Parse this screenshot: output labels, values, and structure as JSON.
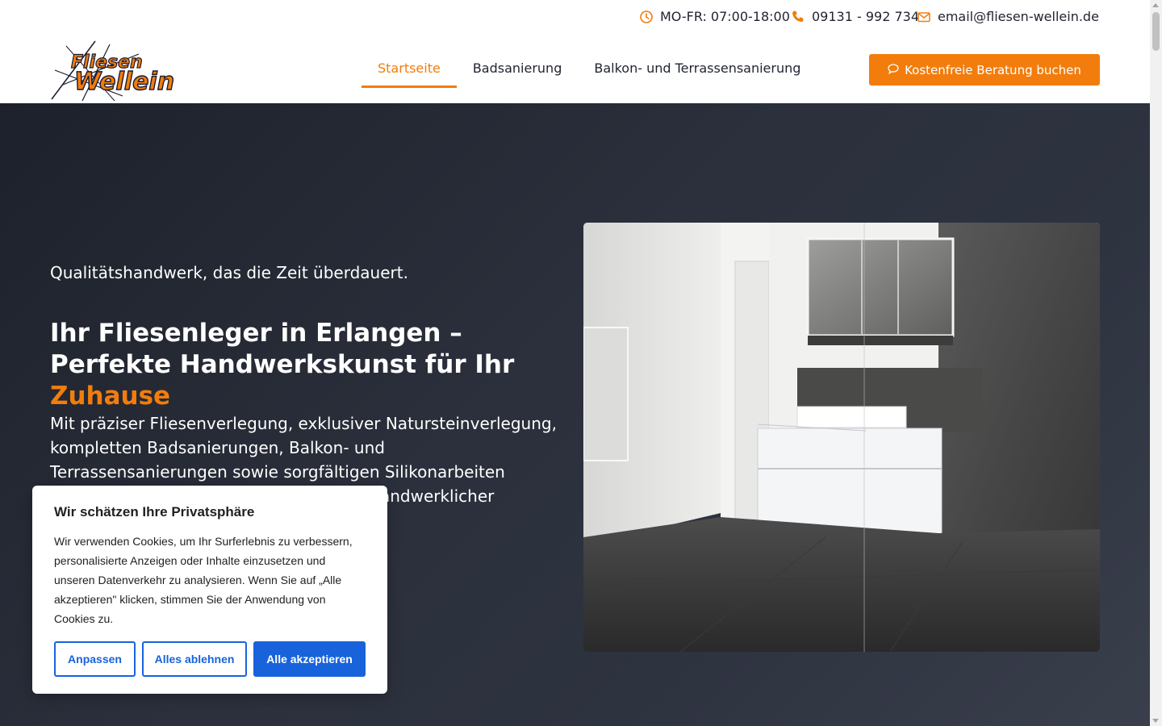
{
  "topbar": {
    "hours": "MO-FR: 07:00-18:00",
    "phone": "09131 - 992 734",
    "email": "email@fliesen-wellein.de"
  },
  "header": {
    "logo_text_top": "Fliesen",
    "logo_text_bottom": "Wellein",
    "nav": [
      {
        "label": "Startseite",
        "active": true
      },
      {
        "label": "Badsanierung",
        "active": false
      },
      {
        "label": "Balkon- und Terrassensanierung",
        "active": false
      }
    ],
    "cta_label": "Kostenfreie Beratung buchen"
  },
  "hero": {
    "eyebrow": "Qualitätshandwerk, das die Zeit überdauert.",
    "headline_main": "Ihr Fliesenleger in Erlangen – Perfekte Handwerkskunst für Ihr ",
    "headline_accent": "Zuhause",
    "lead": "Mit präziser Fliesenverlegung, exklusiver Natursteinverlegung, kompletten Badsanierungen, Balkon- und Terrassensanierungen sowie sorgfältigen Silikonarbeiten verwirklichen wir Ihre Wohnträume mit handwerklicher Perfektion."
  },
  "cookie": {
    "title": "Wir schätzen Ihre Privatsphäre",
    "text": "Wir verwenden Cookies, um Ihr Surferlebnis zu verbessern, personalisierte Anzeigen oder Inhalte einzusetzen und unseren Datenverkehr zu analysieren. Wenn Sie auf „Alle akzeptieren\" klicken, stimmen Sie der Anwendung von Cookies zu.",
    "btn_customize": "Anpassen",
    "btn_reject": "Alles ablehnen",
    "btn_accept": "Alle akzeptieren"
  },
  "colors": {
    "accent": "#f27d0c",
    "hero_bg": "#2b303c",
    "cookie_primary": "#1863dc"
  },
  "icons": [
    "clock-icon",
    "phone-icon",
    "envelope-icon",
    "chat-icon"
  ]
}
